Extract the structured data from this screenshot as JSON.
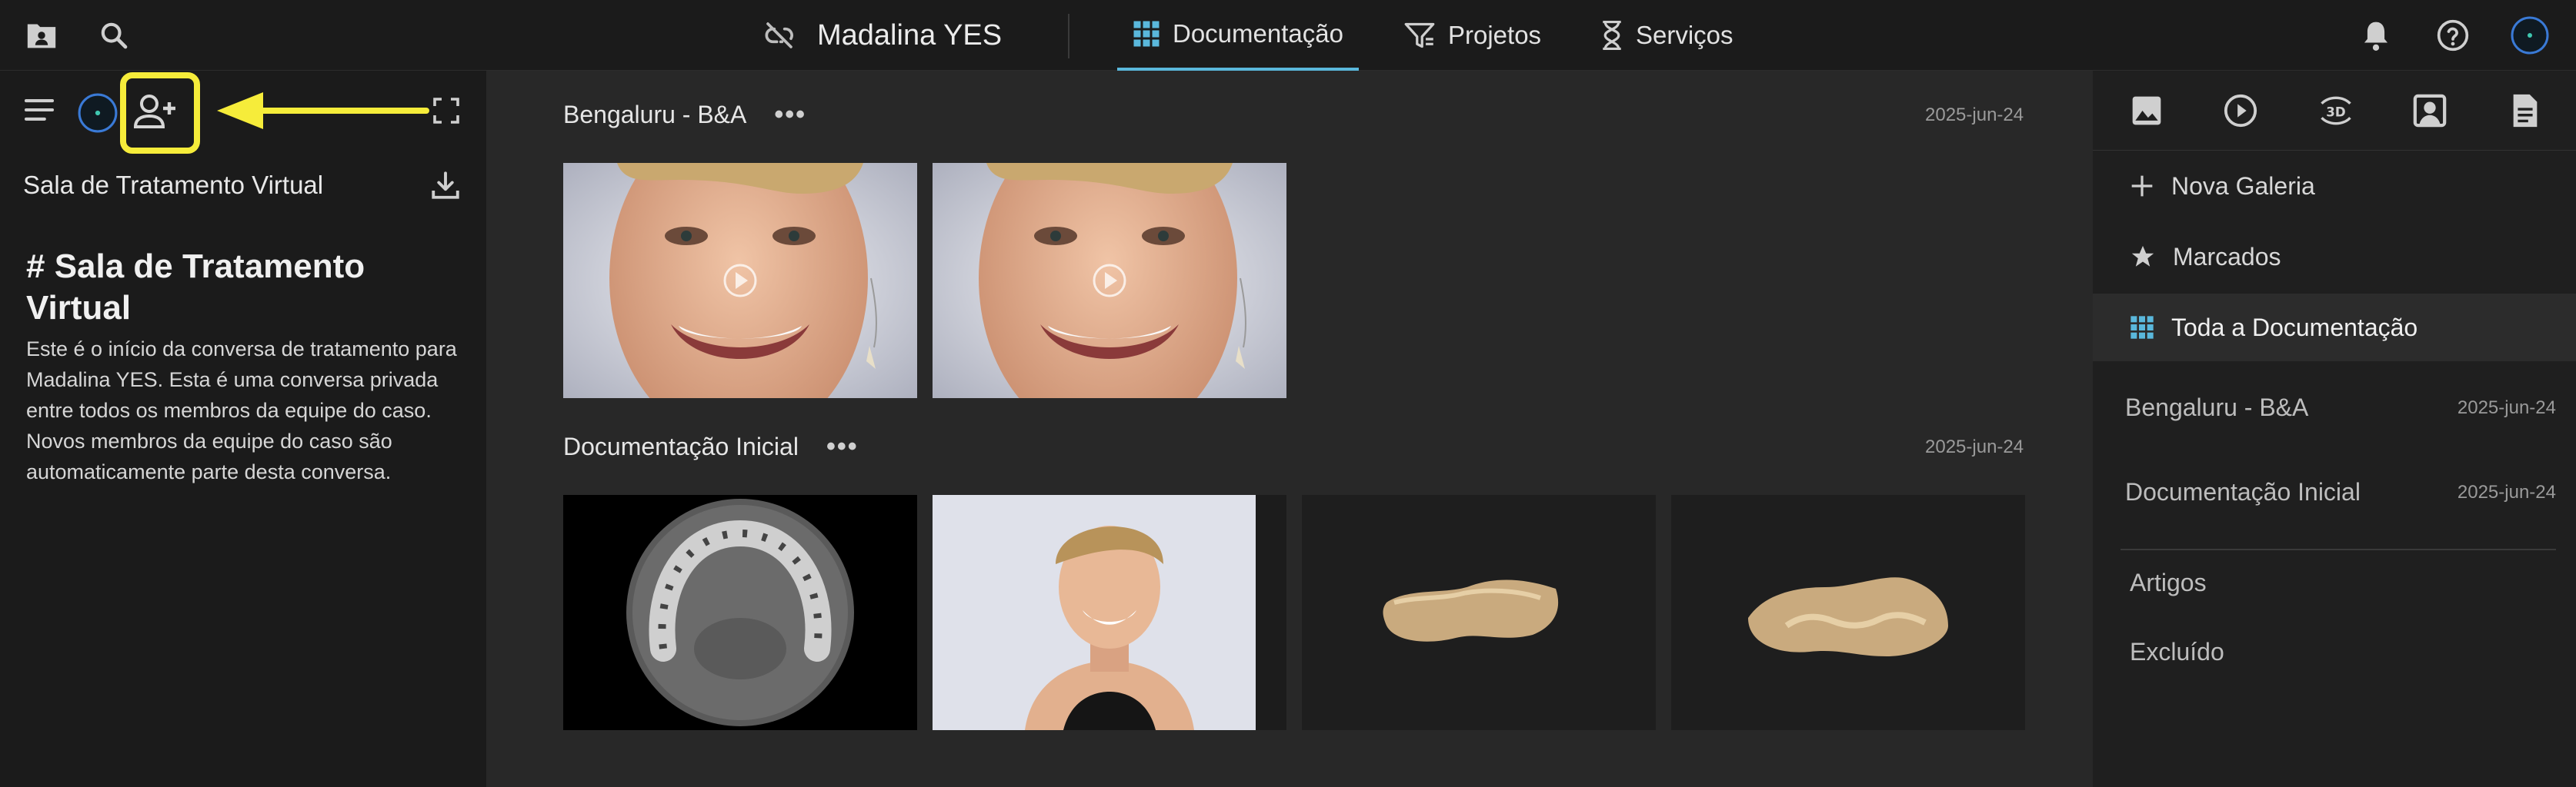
{
  "header": {
    "patient_name": "Madalina YES",
    "tabs": [
      {
        "label": "Documentação",
        "icon": "grid-icon",
        "active": true
      },
      {
        "label": "Projetos",
        "icon": "filter-list-icon",
        "active": false
      },
      {
        "label": "Serviços",
        "icon": "hourglass-icon",
        "active": false
      }
    ]
  },
  "left_panel": {
    "title": "Sala de Tratamento Virtual",
    "heading": "# Sala de Tratamento Virtual",
    "body": "Este é o início da conversa de tratamento para Madalina YES. Esta é uma conversa privada entre todos os membros da equipe do caso. Novos membros da equipe do caso são automaticamente parte desta conversa."
  },
  "main": {
    "sections": [
      {
        "title": "Bengaluru - B&A",
        "date": "2025-jun-24",
        "thumbnails": [
          "video-portrait-smile",
          "video-portrait-smile"
        ]
      },
      {
        "title": "Documentação Inicial",
        "date": "2025-jun-24",
        "thumbnails": [
          "ct-scan-axial",
          "portrait-photo",
          "3d-model-upper",
          "3d-model-lower"
        ]
      }
    ]
  },
  "right_panel": {
    "media_filters": [
      "image-icon",
      "play-icon",
      "3d-icon",
      "portrait-icon",
      "document-icon"
    ],
    "actions": [
      {
        "label": "Nova Galeria",
        "icon": "plus-icon"
      },
      {
        "label": "Marcados",
        "icon": "star-icon"
      },
      {
        "label": "Toda a Documentação",
        "icon": "grid-icon",
        "selected": true
      }
    ],
    "galleries": [
      {
        "label": "Bengaluru - B&A",
        "date": "2025-jun-24"
      },
      {
        "label": "Documentação Inicial",
        "date": "2025-jun-24"
      }
    ],
    "links": [
      "Artigos",
      "Excluído"
    ]
  },
  "colors": {
    "accent": "#5ab8dc",
    "highlight": "#f6ec3a",
    "background": "#202020"
  }
}
